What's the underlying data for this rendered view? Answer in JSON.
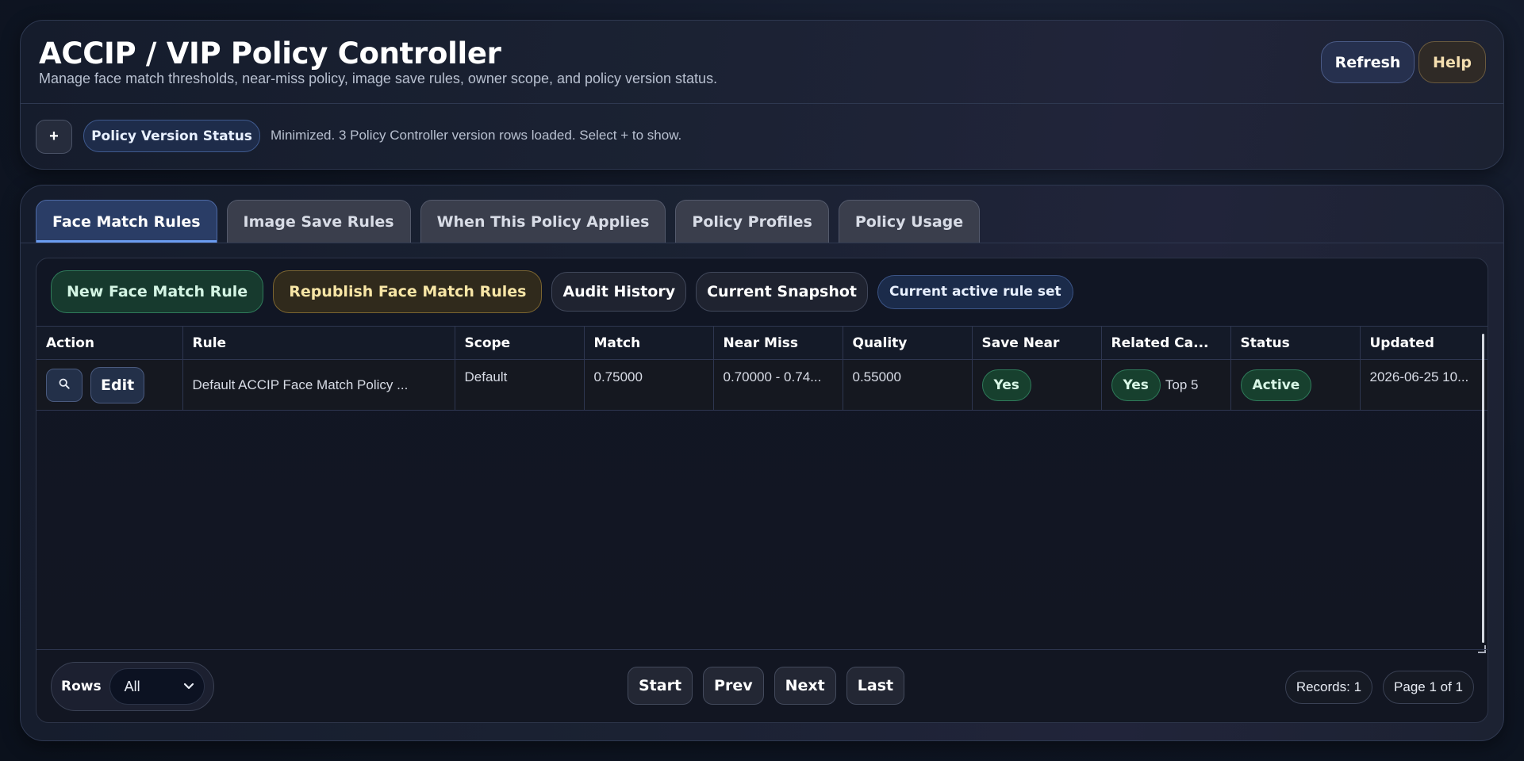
{
  "header": {
    "title": "ACCIP / VIP Policy Controller",
    "subtitle": "Manage face match thresholds, near-miss policy, image save rules, owner scope, and policy version status.",
    "refresh_label": "Refresh",
    "help_label": "Help",
    "toggle_label": "+",
    "version_badge": "Policy Version Status",
    "version_status": "Minimized. 3 Policy Controller version rows loaded. Select + to show."
  },
  "tabs": [
    {
      "label": "Face Match Rules",
      "active": true
    },
    {
      "label": "Image Save Rules",
      "active": false
    },
    {
      "label": "When This Policy Applies",
      "active": false
    },
    {
      "label": "Policy Profiles",
      "active": false
    },
    {
      "label": "Policy Usage",
      "active": false
    }
  ],
  "toolbar": {
    "new_rule_label": "New Face Match Rule",
    "republish_label": "Republish Face Match Rules",
    "audit_label": "Audit History",
    "snapshot_label": "Current Snapshot",
    "active_badge": "Current active rule set"
  },
  "table": {
    "columns": [
      "Action",
      "Rule",
      "Scope",
      "Match",
      "Near Miss",
      "Quality",
      "Save Near",
      "Related Ca...",
      "Status",
      "Updated"
    ],
    "rows": [
      {
        "view_icon": "search-icon",
        "edit_label": "Edit",
        "rule": "Default ACCIP Face Match Policy ...",
        "scope": "Default",
        "match": "0.75000",
        "near_miss": "0.70000 - 0.74...",
        "quality": "0.55000",
        "save_near": "Yes",
        "related_enabled": "Yes",
        "related_top": "Top 5",
        "status": "Active",
        "updated": "2026-06-25 10..."
      }
    ]
  },
  "footer": {
    "rows_label": "Rows",
    "rows_value": "All",
    "start_label": "Start",
    "prev_label": "Prev",
    "next_label": "Next",
    "last_label": "Last",
    "records": "Records: 1",
    "page": "Page 1 of 1"
  },
  "colors": {
    "accent": "#6a9cf0",
    "success": "#2f7a5a",
    "warning": "#7a6430"
  }
}
